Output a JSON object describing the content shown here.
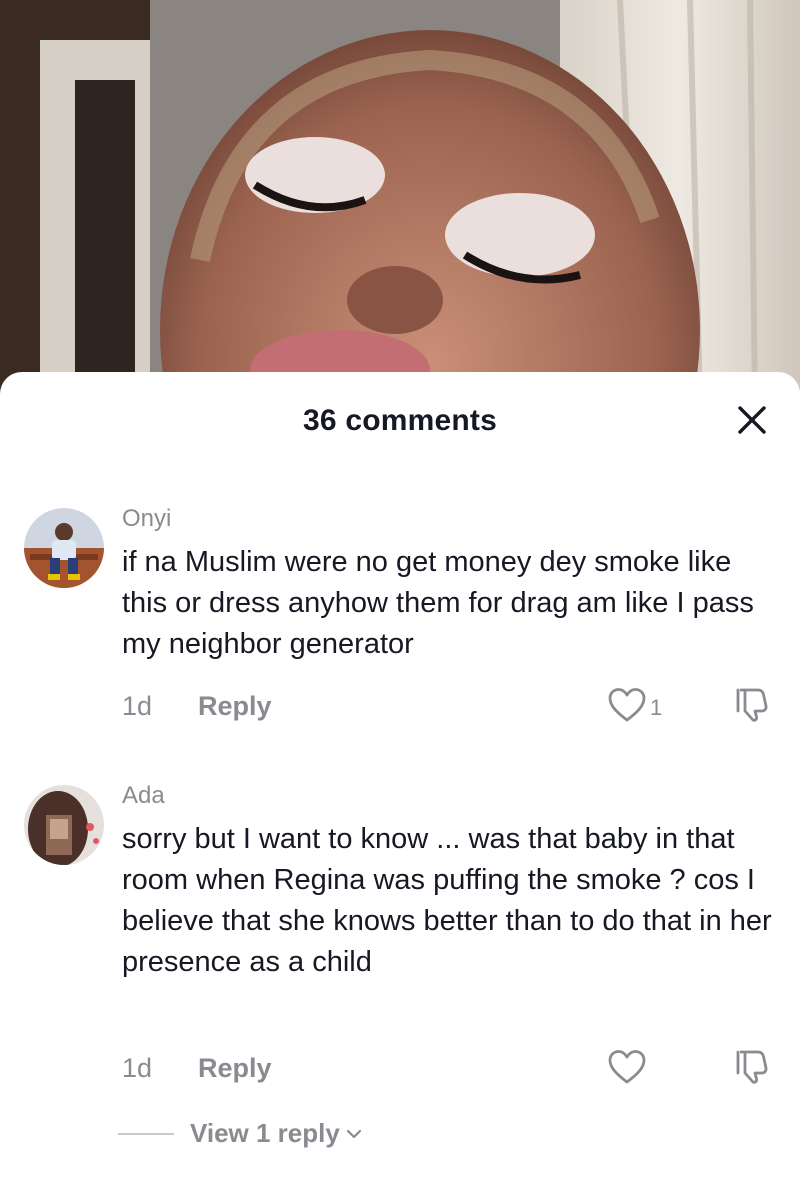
{
  "sheet": {
    "title": "36 comments",
    "close_icon": "close-icon"
  },
  "comments": [
    {
      "username": "Onyi",
      "text": "if na Muslim were no get money dey smoke like this or dress anyhow them for drag am like I pass my neighbor generator",
      "time": "1d",
      "reply_label": "Reply",
      "like_count": "1"
    },
    {
      "username": "Ada",
      "text": "sorry but I want to know ... was that baby in that room when Regina was puffing the smoke ? cos I believe that she knows better than to do that in her presence as a child",
      "time": "1d",
      "reply_label": "Reply",
      "like_count": ""
    }
  ],
  "view_replies_label": "View 1 reply",
  "colors": {
    "text_primary": "#161823",
    "text_secondary": "#8a8b91",
    "background": "#ffffff"
  }
}
